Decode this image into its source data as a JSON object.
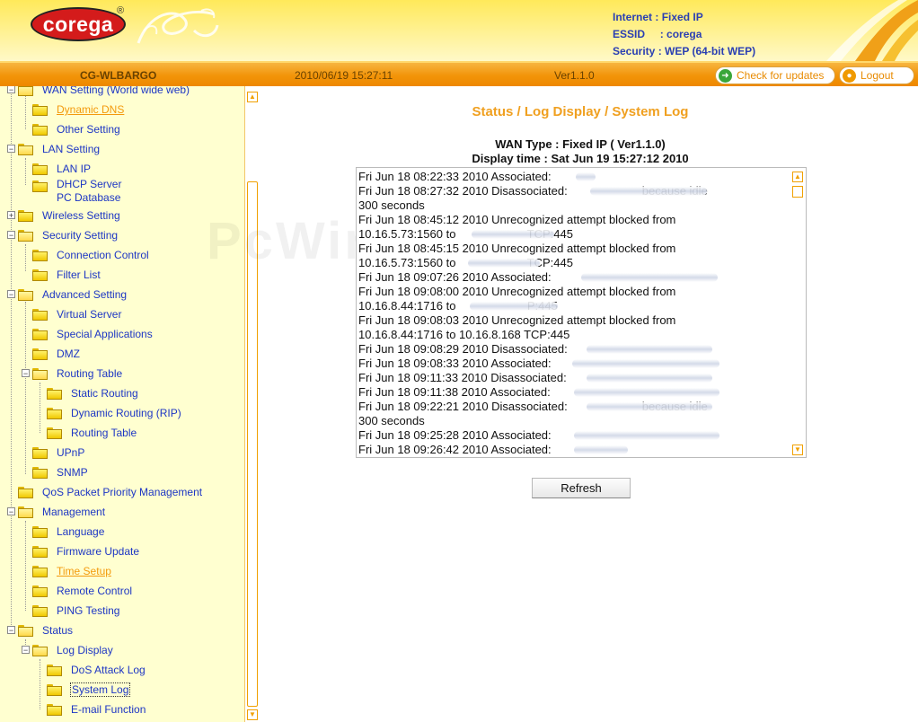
{
  "header": {
    "logo_text": "corega",
    "logo_reg": "®",
    "internet_label": "Internet",
    "internet_value": ": Fixed IP",
    "essid_label": "ESSID",
    "essid_value": ": corega",
    "security_label": "Security",
    "security_value": ": WEP (64-bit WEP)"
  },
  "bar": {
    "model": "CG-WLBARGO",
    "datetime": "2010/06/19 15:27:11",
    "version": "Ver1.1.0",
    "check_updates": "Check for updates",
    "logout": "Logout"
  },
  "sidebar": {
    "items": [
      {
        "label": "WAN Setting (World wide web)"
      },
      {
        "label": "Dynamic DNS"
      },
      {
        "label": "Other Setting"
      },
      {
        "label": "LAN Setting"
      },
      {
        "label": "LAN IP"
      },
      {
        "label": "DHCP Server"
      },
      {
        "label": "PC Database"
      },
      {
        "label": "Wireless Setting"
      },
      {
        "label": "Security Setting"
      },
      {
        "label": "Connection Control"
      },
      {
        "label": "Filter List"
      },
      {
        "label": "Advanced Setting"
      },
      {
        "label": "Virtual Server"
      },
      {
        "label": "Special Applications"
      },
      {
        "label": "DMZ"
      },
      {
        "label": "Routing Table"
      },
      {
        "label": "Static Routing"
      },
      {
        "label": "Dynamic Routing (RIP)"
      },
      {
        "label": "Routing Table"
      },
      {
        "label": "UPnP"
      },
      {
        "label": "SNMP"
      },
      {
        "label": "QoS Packet Priority Management"
      },
      {
        "label": "Management"
      },
      {
        "label": "Language"
      },
      {
        "label": "Firmware Update"
      },
      {
        "label": "Time Setup"
      },
      {
        "label": "Remote Control"
      },
      {
        "label": "PING Testing"
      },
      {
        "label": "Status"
      },
      {
        "label": "Log Display"
      },
      {
        "label": "DoS Attack Log"
      },
      {
        "label": "System Log"
      },
      {
        "label": "E-mail Function"
      }
    ]
  },
  "main": {
    "title": "Status / Log Display / System Log",
    "wan_type": "WAN Type : Fixed IP ( Ver1.1.0)",
    "display_time": "Display time : Sat Jun 19 15:27:12 2010",
    "log_lines": [
      "Fri Jun 18 08:22:33 2010 Associated:",
      "Fri Jun 18 08:27:32 2010 Disassociated:                       because idle",
      "300 seconds",
      "Fri Jun 18 08:45:12 2010 Unrecognized attempt blocked from",
      "10.16.5.73:1560 to                      TCP:445",
      "Fri Jun 18 08:45:15 2010 Unrecognized attempt blocked from",
      "10.16.5.73:1560 to                      TCP:445",
      "Fri Jun 18 09:07:26 2010 Associated:",
      "Fri Jun 18 09:08:00 2010 Unrecognized attempt blocked from",
      "10.16.8.44:1716 to                      P:445",
      "Fri Jun 18 09:08:03 2010 Unrecognized attempt blocked from",
      "10.16.8.44:1716 to 10.16.8.168 TCP:445",
      "Fri Jun 18 09:08:29 2010 Disassociated:",
      "Fri Jun 18 09:08:33 2010 Associated:",
      "Fri Jun 18 09:11:33 2010 Disassociated:",
      "Fri Jun 18 09:11:38 2010 Associated:",
      "Fri Jun 18 09:22:21 2010 Disassociated:                       because idle",
      "300 seconds",
      "Fri Jun 18 09:25:28 2010 Associated:",
      "Fri Jun 18 09:26:42 2010 Associated:"
    ],
    "refresh_label": "Refresh"
  },
  "watermark": "PcWinTech.com",
  "colors": {
    "header_yellow": "#ffe95a",
    "bar_orange": "#f29409",
    "link_blue": "#1d36c4",
    "title_orange": "#f0a020",
    "sidebar_bg": "#ffffd0"
  }
}
